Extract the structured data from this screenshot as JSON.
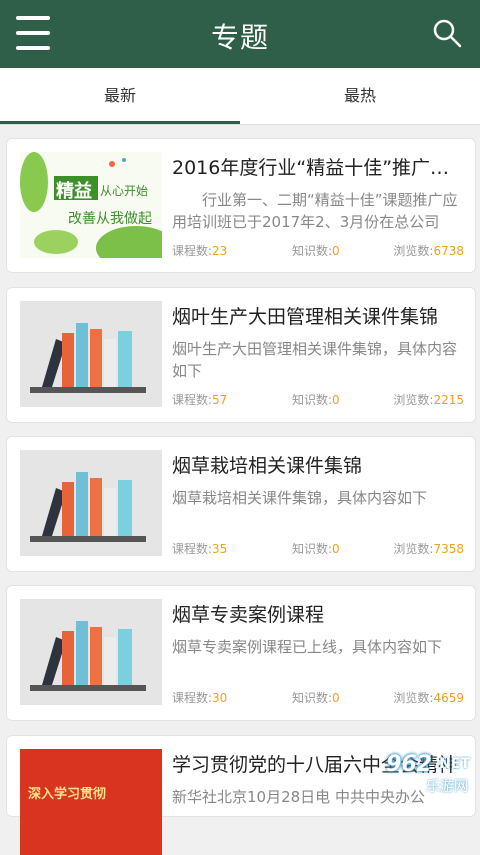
{
  "header": {
    "title": "专题",
    "menu_icon": "menu-icon",
    "search_icon": "search-icon",
    "color": "#2f5f49"
  },
  "tabs": [
    {
      "label": "最新",
      "active": true
    },
    {
      "label": "最热",
      "active": false
    }
  ],
  "cards": [
    {
      "title": "2016年度行业“精益十佳”推广课...",
      "desc": "行业第一、二期“精益十佳”课题推广应用培训班已于2017年2、3月份在总公司职...",
      "courses_label": "课程数:",
      "courses": "23",
      "knowledge_label": "知识数:",
      "knowledge": "0",
      "views_label": "浏览数:",
      "views": "6738",
      "thumb_title": "精益",
      "thumb_text1": "从心开始",
      "thumb_text2": "改善从我做起"
    },
    {
      "title": "烟叶生产大田管理相关课件集锦",
      "desc": "烟叶生产大田管理相关课件集锦，具体内容如下",
      "courses_label": "课程数:",
      "courses": "57",
      "knowledge_label": "知识数:",
      "knowledge": "0",
      "views_label": "浏览数:",
      "views": "2215"
    },
    {
      "title": "烟草栽培相关课件集锦",
      "desc": "烟草栽培相关课件集锦，具体内容如下",
      "courses_label": "课程数:",
      "courses": "35",
      "knowledge_label": "知识数:",
      "knowledge": "0",
      "views_label": "浏览数:",
      "views": "7358"
    },
    {
      "title": "烟草专卖案例课程",
      "desc": "烟草专卖案例课程已上线，具体内容如下",
      "courses_label": "课程数:",
      "courses": "30",
      "knowledge_label": "知识数:",
      "knowledge": "0",
      "views_label": "浏览数:",
      "views": "4659"
    },
    {
      "title": "学习贯彻党的十八届六中全会精神",
      "desc": "新华社北京10月28日电 中共中央办公",
      "thumb_text": "深入学习贯彻"
    }
  ],
  "watermark": {
    "brand": "962",
    "suffix": ".NET",
    "sub": "乐游网"
  }
}
